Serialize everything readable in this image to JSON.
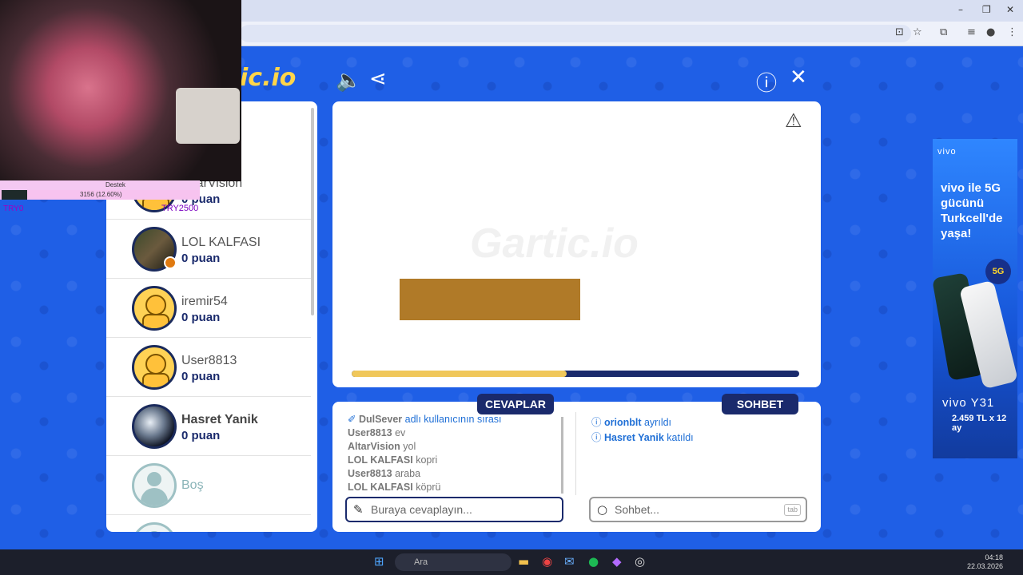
{
  "browser": {
    "window_controls": [
      "–",
      "❐",
      "✕"
    ],
    "toolbar_icons": [
      "install-icon",
      "star-icon",
      "extensions-icon",
      "menu-icon"
    ]
  },
  "header": {
    "logo_fragment": "ic.io",
    "icons": [
      "sound-icon",
      "share-icon",
      "info-icon",
      "close-icon"
    ]
  },
  "players": [
    {
      "name": "AltarVision",
      "score": "0 puan",
      "avatar": "smile"
    },
    {
      "name": "LOL KALFASI",
      "score": "0 puan",
      "avatar": "photo1"
    },
    {
      "name": "iremir54",
      "score": "0 puan",
      "avatar": "smile"
    },
    {
      "name": "User8813",
      "score": "0 puan",
      "avatar": "smile"
    },
    {
      "name": "Hasret Yanik",
      "score": "0 puan",
      "avatar": "photo2"
    },
    {
      "name": "Boş",
      "score": "",
      "avatar": "empty"
    }
  ],
  "canvas": {
    "watermark": "Gartic.io",
    "timer_progress": 0.48,
    "drawing_color": "#b07a28"
  },
  "tabs": {
    "answers_label": "CEVAPLAR",
    "chat_label": "SOHBET"
  },
  "answers": [
    {
      "user": "DulSever",
      "text": "adlı kullanıcının sırası",
      "system": true
    },
    {
      "user": "User8813",
      "text": "ev"
    },
    {
      "user": "AltarVision",
      "text": "yol"
    },
    {
      "user": "LOL KALFASI",
      "text": "kopri"
    },
    {
      "user": "User8813",
      "text": "araba"
    },
    {
      "user": "LOL KALFASI",
      "text": "köprü"
    }
  ],
  "chat": [
    {
      "user": "orionblt",
      "text": "ayrıldı"
    },
    {
      "user": "Hasret Yanik",
      "text": "katıldı"
    }
  ],
  "inputs": {
    "answer_placeholder": "Buraya cevaplayın...",
    "chat_placeholder": "Sohbet...",
    "tab_hint": "tab"
  },
  "ad": {
    "brand": "vivo",
    "headline": "vivo ile 5G gücünü Turkcell'de yaşa!",
    "badge": "5G",
    "model": "vivo Y31",
    "price": "2.459 TL x 12 ay"
  },
  "overlay": {
    "donate_label": "Destek",
    "donate_value": "3156 (12.60%)",
    "try_left": "TRY0",
    "try_right": "TRY2500"
  },
  "taskbar": {
    "search_placeholder": "Ara",
    "time": "04:18",
    "date": "22.03.2026"
  },
  "colors": {
    "page_blue": "#1f5fe6",
    "navy": "#1a2a6c",
    "timer_yellow": "#f0c75a"
  }
}
